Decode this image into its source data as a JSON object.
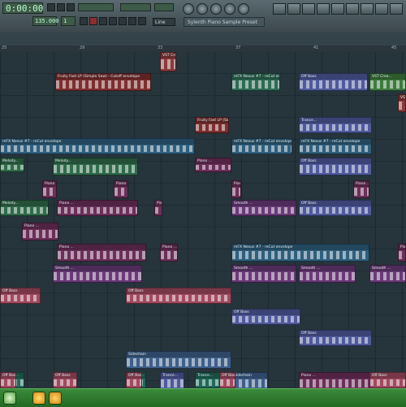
{
  "transport": {
    "time_display": "0:00:00",
    "tempo_display": "135.000",
    "pattern_display": "1",
    "pattern_name": "Line",
    "hint_text": "Sylenth Piano Sample Preset"
  },
  "timeline": {
    "bars": [
      "25",
      "",
      "",
      "",
      "29",
      "",
      "",
      "",
      "33",
      "",
      "",
      "",
      "37",
      "",
      "",
      "",
      "41",
      "",
      "",
      "",
      "45"
    ]
  },
  "clips": [
    {
      "label": "VST Crea...",
      "color": "#8a3a3a"
    },
    {
      "label": "Fruity Fast LP (Simple Saw) - Cutoff envelope",
      "color": "#7d2f2f"
    },
    {
      "label": "mFX Nexus #7 - reCut envelope",
      "color": "#2e6b54"
    },
    {
      "label": "Off Bass",
      "color": "#4f5a9c"
    },
    {
      "label": "Trance...",
      "color": "#4f5a9c"
    },
    {
      "label": "VST Crea...",
      "color": "#3d7a3d"
    },
    {
      "label": "mFX Nexus #7 - reCut envelope",
      "color": "#2f5f7d"
    },
    {
      "label": "Melody...",
      "color": "#2f6b4a"
    },
    {
      "label": "Piano ...",
      "color": "#6b2f5a"
    },
    {
      "label": "Smooth ...",
      "color": "#6a3a78"
    },
    {
      "label": "Off Bass",
      "color": "#a04a60"
    },
    {
      "label": "Sidechain",
      "color": "#3e5f8a"
    },
    {
      "label": "Trance...",
      "color": "#1f6a5a"
    }
  ],
  "taskbar": {
    "apps": [
      "utorrent",
      "fl-studio",
      "winamp"
    ]
  }
}
